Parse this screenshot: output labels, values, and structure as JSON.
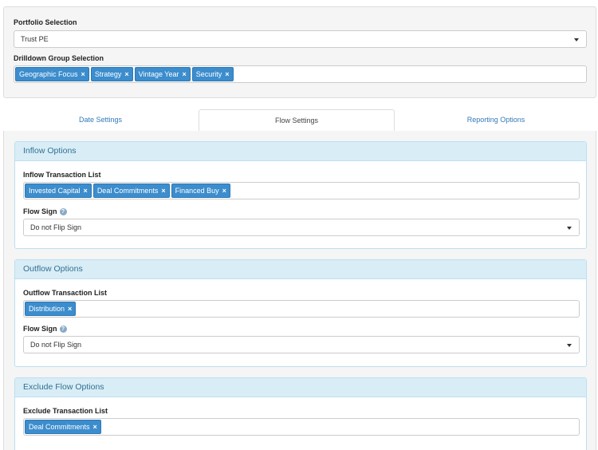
{
  "portfolio": {
    "label": "Portfolio Selection",
    "selected": "Trust PE"
  },
  "drilldown": {
    "label": "Drilldown Group Selection",
    "tags": [
      "Geographic Focus",
      "Strategy",
      "Vintage Year",
      "Security"
    ]
  },
  "tabs": [
    {
      "label": "Date Settings",
      "active": false
    },
    {
      "label": "Flow Settings",
      "active": true
    },
    {
      "label": "Reporting Options",
      "active": false
    }
  ],
  "inflow": {
    "title": "Inflow Options",
    "list_label": "Inflow Transaction List",
    "tags": [
      "Invested Capital",
      "Deal Commitments",
      "Financed Buy"
    ],
    "sign_label": "Flow Sign",
    "sign_value": "Do not Flip Sign"
  },
  "outflow": {
    "title": "Outflow Options",
    "list_label": "Outflow Transaction List",
    "tags": [
      "Distribution"
    ],
    "sign_label": "Flow Sign",
    "sign_value": "Do not Flip Sign"
  },
  "exclude": {
    "title": "Exclude Flow Options",
    "list_label": "Exclude Transaction List",
    "tags": [
      "Deal Commitments"
    ]
  },
  "icons": {
    "remove": "×",
    "help": "?"
  },
  "colors": {
    "tag_bg": "#3c8dcd",
    "section_header_bg": "#d9edf7",
    "section_header_text": "#31708f",
    "link": "#337ab7"
  }
}
